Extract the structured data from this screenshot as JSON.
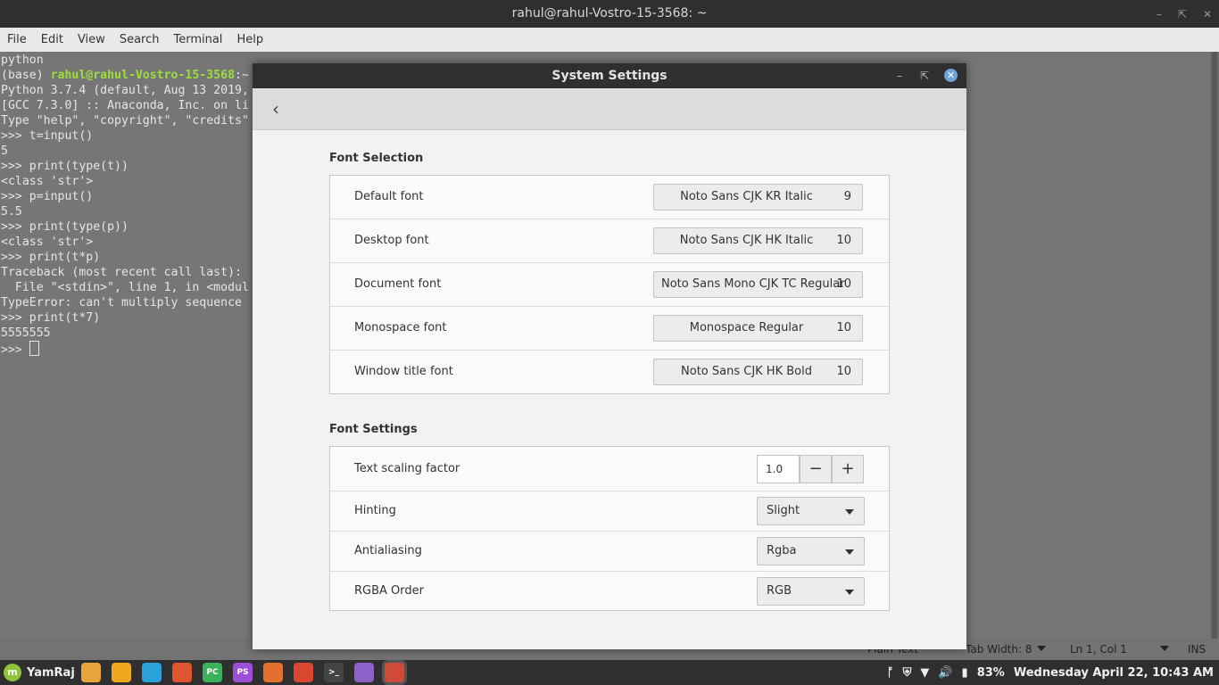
{
  "terminal": {
    "title": "rahul@rahul-Vostro-15-3568: ~",
    "menu": [
      "File",
      "Edit",
      "View",
      "Search",
      "Terminal",
      "Help"
    ],
    "prompt_prefix": "(base) ",
    "prompt_user": "rahul@rahul-Vostro-15-3568",
    "prompt_suffix": ":~",
    "lines_before": [
      "python"
    ],
    "lines_after": [
      "Python 3.7.4 (default, Aug 13 2019,",
      "[GCC 7.3.0] :: Anaconda, Inc. on li",
      "Type \"help\", \"copyright\", \"credits\"",
      ">>> t=input()",
      "5",
      ">>> print(type(t))",
      "<class 'str'>",
      ">>> p=input()",
      "5.5",
      ">>> print(type(p))",
      "<class 'str'>",
      ">>> print(t*p)",
      "Traceback (most recent call last):",
      "  File \"<stdin>\", line 1, in <modul",
      "TypeError: can't multiply sequence",
      ">>> print(t*7)",
      "5555555"
    ],
    "last_prompt": ">>> ",
    "status": {
      "plain_text": "Plain Text",
      "tab_width": "Tab Width: 8",
      "position": "Ln 1, Col 1",
      "mode": "INS"
    }
  },
  "dialog": {
    "title": "System Settings",
    "back_icon": "chevron-left-icon",
    "font_selection": {
      "title": "Font Selection",
      "rows": [
        {
          "label": "Default font",
          "font": "Noto Sans CJK KR Italic",
          "size": "9"
        },
        {
          "label": "Desktop font",
          "font": "Noto Sans CJK HK Italic",
          "size": "10"
        },
        {
          "label": "Document font",
          "font": "Noto Sans Mono CJK TC Regular",
          "size": "10"
        },
        {
          "label": "Monospace font",
          "font": "Monospace Regular",
          "size": "10"
        },
        {
          "label": "Window title font",
          "font": "Noto Sans CJK HK Bold",
          "size": "10"
        }
      ]
    },
    "font_settings": {
      "title": "Font Settings",
      "scaling": {
        "label": "Text scaling factor",
        "value": "1.0",
        "minus": "−",
        "plus": "+"
      },
      "hinting": {
        "label": "Hinting",
        "value": "Slight"
      },
      "antialiasing": {
        "label": "Antialiasing",
        "value": "Rgba"
      },
      "rgba_order": {
        "label": "RGBA Order",
        "value": "RGB"
      }
    }
  },
  "taskbar": {
    "menu_label": "YamRaj",
    "apps": [
      {
        "name": "show-desktop",
        "glyph": "",
        "color": "#e8a33a"
      },
      {
        "name": "files",
        "glyph": "",
        "color": "#f0a81f"
      },
      {
        "name": "telegram",
        "glyph": "",
        "color": "#2aa1da"
      },
      {
        "name": "brave",
        "glyph": "",
        "color": "#e0552f"
      },
      {
        "name": "pycharm",
        "glyph": "PC",
        "color": "#3db05a"
      },
      {
        "name": "phpstorm",
        "glyph": "PS",
        "color": "#9b4fd8"
      },
      {
        "name": "firefox",
        "glyph": "",
        "color": "#e3702c"
      },
      {
        "name": "chrome",
        "glyph": "",
        "color": "#d9472f"
      },
      {
        "name": "terminal",
        "glyph": ">_",
        "color": "#444444"
      },
      {
        "name": "text-editor",
        "glyph": "",
        "color": "#8c62c9"
      },
      {
        "name": "system-settings",
        "glyph": "",
        "color": "#d04a3a"
      }
    ],
    "battery": "83%",
    "datetime": "Wednesday April 22, 10:43 AM"
  }
}
